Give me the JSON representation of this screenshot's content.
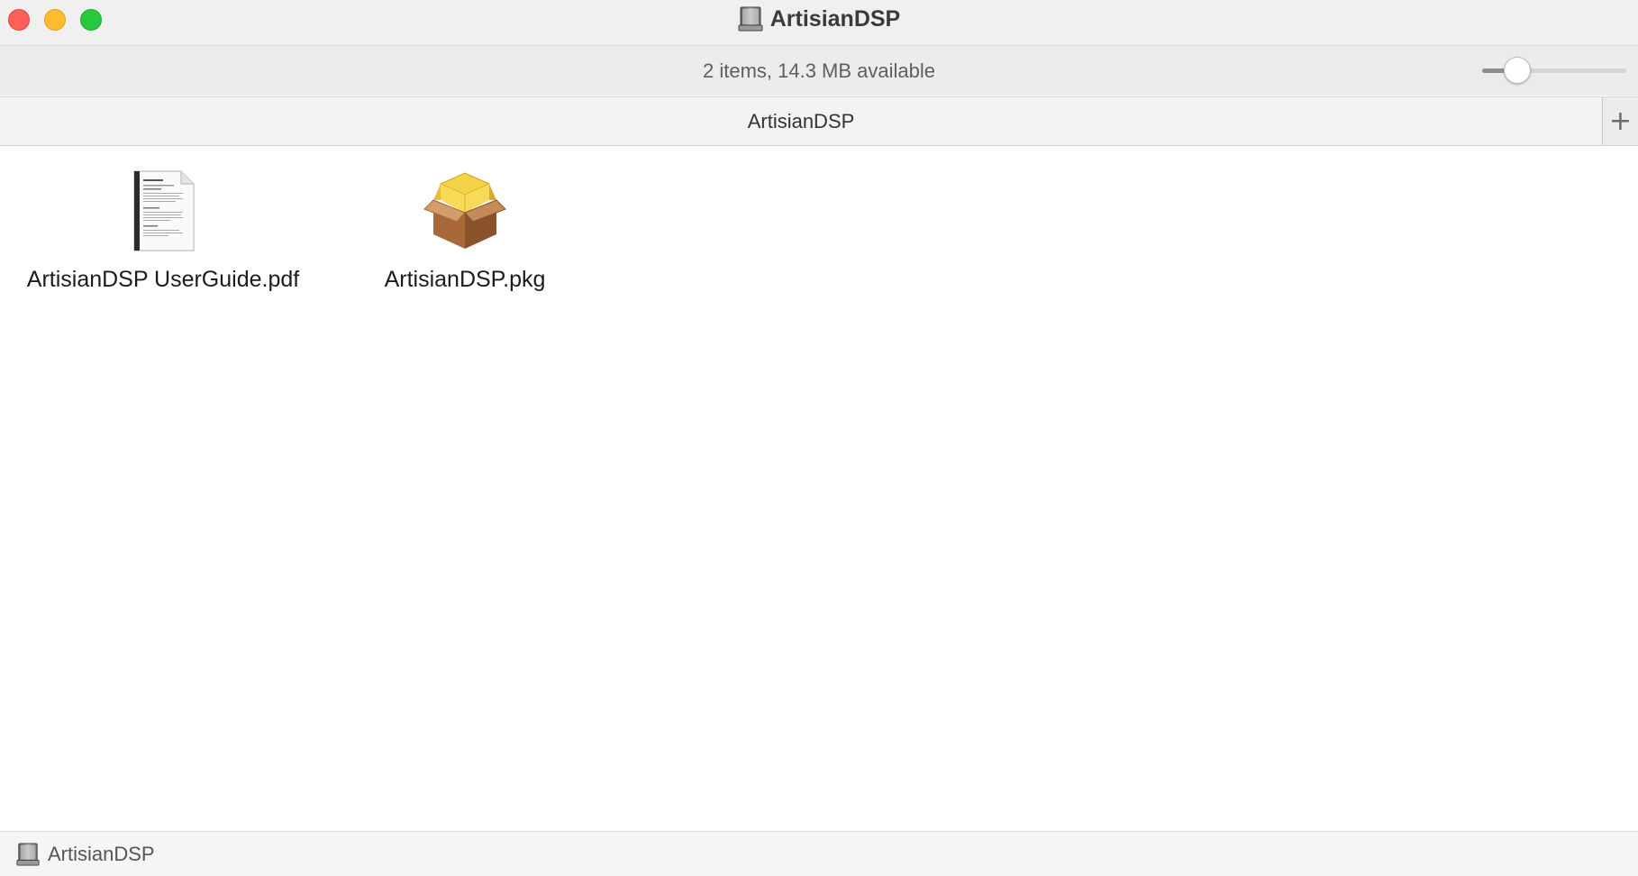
{
  "window": {
    "title": "ArtisianDSP",
    "title_icon": "disk-image-icon",
    "controls": [
      "close",
      "minimize",
      "zoom"
    ],
    "colors": {
      "close": "#fe5f57",
      "minimize": "#febc2e",
      "zoom": "#28c840"
    }
  },
  "status": {
    "text": "2 items, 14.3 MB available",
    "icon_size_slider_value": 0.2
  },
  "tabbar": {
    "current_tab": "ArtisianDSP",
    "add_tab_icon": "plus-icon"
  },
  "files": [
    {
      "name": "ArtisianDSP UserGuide.pdf",
      "icon": "pdf-document-icon"
    },
    {
      "name": "ArtisianDSP.pkg",
      "icon": "package-installer-icon"
    }
  ],
  "pathbar": {
    "crumbs": [
      {
        "label": "ArtisianDSP",
        "icon": "disk-image-icon"
      }
    ]
  }
}
